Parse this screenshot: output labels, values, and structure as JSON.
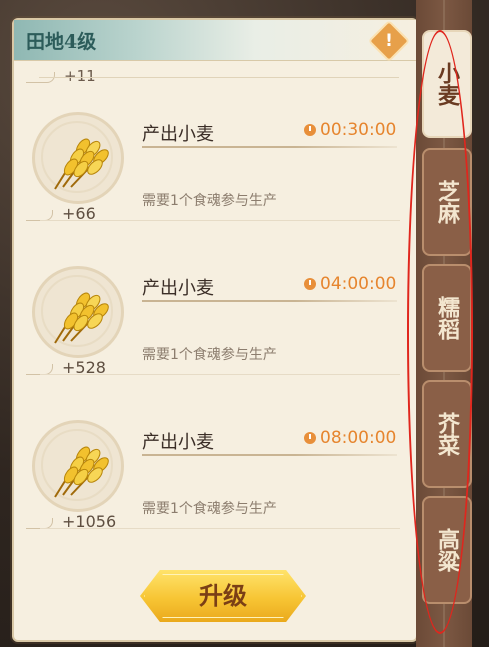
{
  "header": {
    "title": "田地4级",
    "warn_glyph": "!"
  },
  "top_partial": {
    "plus": "+11"
  },
  "rows": [
    {
      "output": "产出小麦",
      "timer": "00:30:00",
      "requirement": "需要1个食魂参与生产",
      "plus": "+66"
    },
    {
      "output": "产出小麦",
      "timer": "04:00:00",
      "requirement": "需要1个食魂参与生产",
      "plus": "+528"
    },
    {
      "output": "产出小麦",
      "timer": "08:00:00",
      "requirement": "需要1个食魂参与生产",
      "plus": "+1056"
    }
  ],
  "upgrade": {
    "label": "升级"
  },
  "tabs": [
    {
      "label": "小麦",
      "active": true
    },
    {
      "label": "芝麻",
      "active": false
    },
    {
      "label": "糯稻",
      "active": false
    },
    {
      "label": "芥菜",
      "active": false
    },
    {
      "label": "高粱",
      "active": false
    }
  ],
  "colors": {
    "accent": "#e6852e",
    "tab_bg": "#8a5f47",
    "panel_bg": "#f6efe0",
    "highlight_oval": "#e0261d"
  }
}
